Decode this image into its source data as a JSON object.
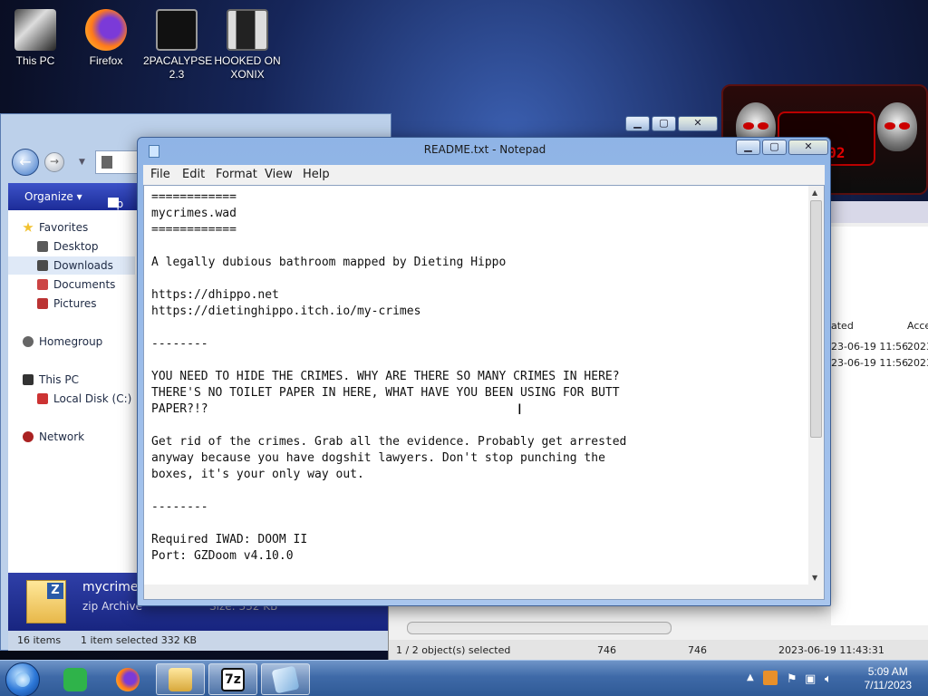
{
  "desktop_icons": [
    {
      "label": "This PC",
      "color": "#c8c8c8"
    },
    {
      "label": "Firefox",
      "color": "#ff7a1a"
    },
    {
      "label": "2PACALYPSE 2.3",
      "color": "#222222"
    },
    {
      "label": "HOOKED ON XONIX",
      "color": "#3a3a3a"
    }
  ],
  "widget": {
    "time": "2:02"
  },
  "explorer": {
    "toolbar": {
      "organize": "Organize ▾",
      "open": "Op"
    },
    "sidebar": {
      "favorites": "Favorites",
      "desktop": "Desktop",
      "downloads": "Downloads",
      "documents": "Documents",
      "pictures": "Pictures",
      "homegroup": "Homegroup",
      "this_pc": "This PC",
      "local_disk": "Local Disk (C:)",
      "network": "Network"
    },
    "details": {
      "name": "mycrimes",
      "type": "zip Archive",
      "size": "Size: 332 KB"
    },
    "status": {
      "items": "16 items",
      "selected": "1 item selected  332 KB"
    }
  },
  "zip": {
    "col_created": "ated",
    "col_accessed": "Acce",
    "rows": [
      {
        "created": "23-06-19 11:56",
        "accessed": "2023"
      },
      {
        "created": "23-06-19 11:56",
        "accessed": "2023"
      }
    ],
    "status": {
      "selected": "1 / 2 object(s) selected",
      "size": "746",
      "packed": "746",
      "date": "2023-06-19 11:43:31"
    }
  },
  "notepad": {
    "title": "README.txt - Notepad",
    "menu": {
      "file": "File",
      "edit": "Edit",
      "format": "Format",
      "view": "View",
      "help": "Help"
    },
    "content": "============\nmycrimes.wad\n============\n\nA legally dubious bathroom mapped by Dieting Hippo\n\nhttps://dhippo.net\nhttps://dietinghippo.itch.io/my-crimes\n\n--------\n\nYOU NEED TO HIDE THE CRIMES. WHY ARE THERE SO MANY CRIMES IN HERE?\nTHERE'S NO TOILET PAPER IN HERE, WHAT HAVE YOU BEEN USING FOR BUTT\nPAPER?!?\n\nGet rid of the crimes. Grab all the evidence. Probably get arrested\nanyway because you have dogshit lawyers. Don't stop punching the\nboxes, it's your only way out.\n\n--------\n\nRequired IWAD: DOOM II\nPort: GZDoom v4.10.0"
  },
  "taskbar": {
    "clock_time": "5:09 AM",
    "clock_date": "7/11/2023",
    "pinned": [
      {
        "name": "sticky",
        "color": "#2fb34a"
      },
      {
        "name": "firefox",
        "color": "#ff7a1a"
      },
      {
        "name": "explorer",
        "color": "#e6b84a"
      },
      {
        "name": "7zip",
        "color": "#111111"
      },
      {
        "name": "notepad",
        "color": "#9cc4e8"
      }
    ]
  }
}
